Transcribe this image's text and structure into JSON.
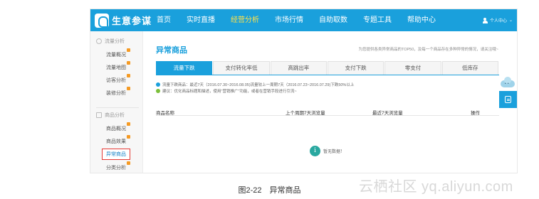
{
  "app": {
    "logo_text": "生意参谋"
  },
  "nav": {
    "items": [
      {
        "label": "首页"
      },
      {
        "label": "实时直播"
      },
      {
        "label": "经营分析"
      },
      {
        "label": "市场行情"
      },
      {
        "label": "自助取数"
      },
      {
        "label": "专题工具"
      },
      {
        "label": "帮助中心"
      }
    ],
    "user_label": "个人中心"
  },
  "sidebar": {
    "group1": "流量分析",
    "group1_items": [
      {
        "label": "流量概况"
      },
      {
        "label": "流量地图"
      },
      {
        "label": "访客分析"
      },
      {
        "label": "装修分析"
      }
    ],
    "group2": "商品分析",
    "group2_items": [
      {
        "label": "商品概况"
      },
      {
        "label": "商品效果"
      },
      {
        "label": "异常商品"
      },
      {
        "label": "分类分析"
      }
    ]
  },
  "main": {
    "title": "异常商品",
    "hint": "为您提供各类异常商品的TOP50，及每一个商品存在多种异常的情况，请关注哦~",
    "tabs": [
      {
        "label": "流量下跌"
      },
      {
        "label": "支付转化率低"
      },
      {
        "label": "高跳出率"
      },
      {
        "label": "支付下跌"
      },
      {
        "label": "零支付"
      },
      {
        "label": "低库存"
      }
    ],
    "notice1": "流量下跌商品：最近7天（2016.07.30~2016.08.05)流量较上一周期7天（2016.07.23~2016.07.29)下跌50%以上",
    "notice2": "建议：优化商品标题和描述，使用\"营销推广\"功能，或者在营销手段进行引流~",
    "columns": [
      "商品名称",
      "上个周期7天浏览量",
      "最近7天浏览量",
      "操作"
    ],
    "empty_text": "暂无数据！"
  },
  "caption": "图2-22　异常商品",
  "watermark": "云栖社区 yq.aliyun.com",
  "colors": {
    "primary": "#1aa0dc",
    "nav_active": "#ffe14a",
    "highlight_border": "#e53935",
    "tag": "#f59a23"
  }
}
